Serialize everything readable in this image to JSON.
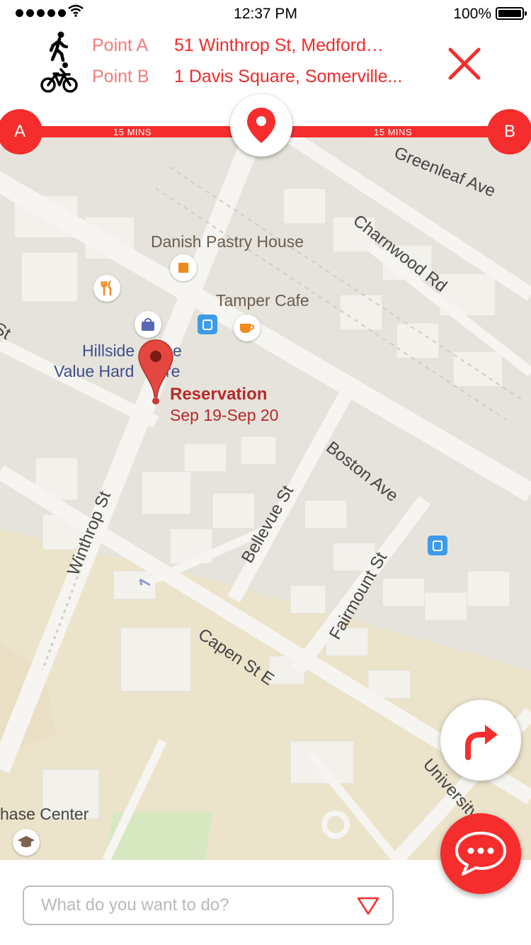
{
  "status_bar": {
    "time": "12:37 PM",
    "battery": "100%"
  },
  "route": {
    "a": {
      "label": "Point A",
      "address": "51 Winthrop St, Medford…",
      "mode_icon": "walking-icon"
    },
    "b": {
      "label": "Point B",
      "address": "1 Davis Square, Somerville...",
      "mode_icon": "bicycle-icon"
    }
  },
  "timeline": {
    "start": "A",
    "end": "B",
    "leg1": "15 MINS",
    "leg2": "15 MINS"
  },
  "map": {
    "places": {
      "danish": "Danish Pastry House",
      "tamper": "Tamper Cafe",
      "hillside1": "Hillside",
      "hillside1b": "e",
      "hillside2": "Value Hard",
      "hillside2b": "re",
      "chase": "hase Center"
    },
    "streets": {
      "greenleaf": "Greenleaf Ave",
      "charnwood": "Charnwood Rd",
      "boston": "Boston Ave",
      "winthrop": "Winthrop St",
      "bellevue": "Bellevue St",
      "fairmount": "Fairmount St",
      "capen": "Capen St E",
      "university": "University Ave",
      "st_left": "St"
    },
    "reservation": {
      "title": "Reservation",
      "dates": "Sep 19-Sep 20"
    }
  },
  "search": {
    "placeholder": "What do you want to do?"
  },
  "colors": {
    "accent": "#f52d2d",
    "map_bg": "#e6e3dc",
    "road": "#f7f5f1"
  }
}
